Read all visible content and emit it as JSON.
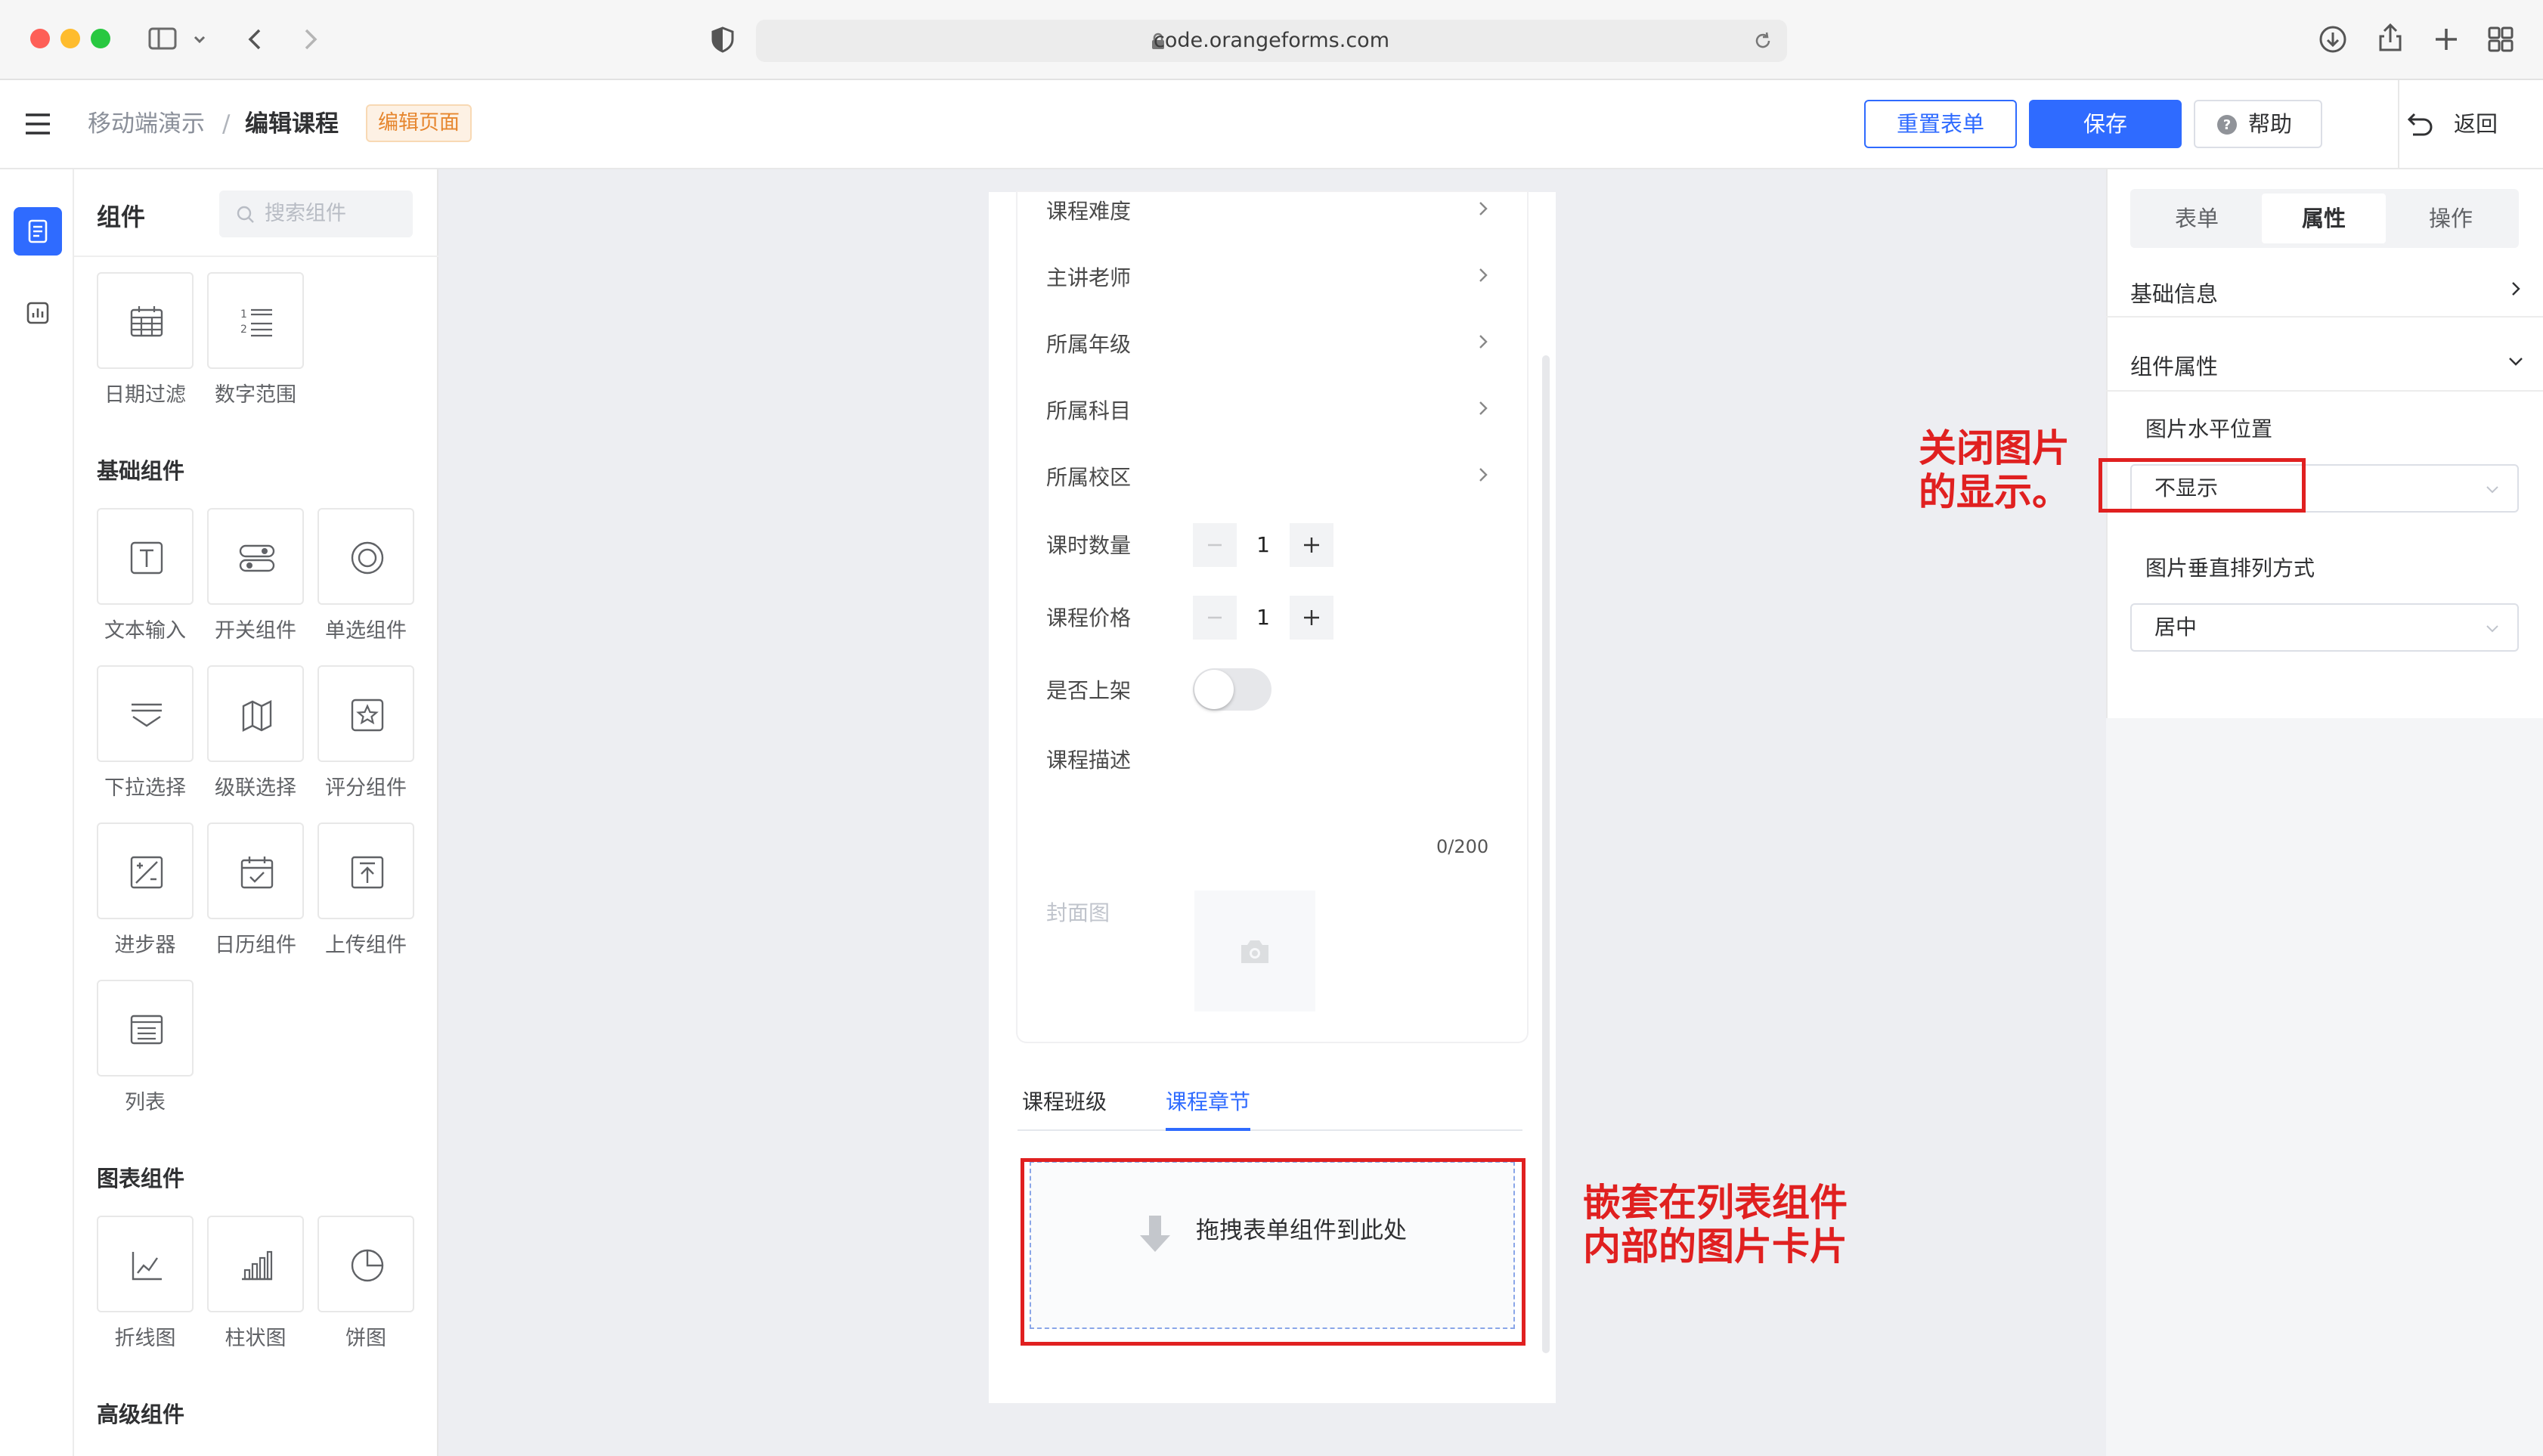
{
  "browser": {
    "url": "code.orangeforms.com"
  },
  "header": {
    "breadcrumb_root": "移动端演示",
    "breadcrumb_sep": "/",
    "breadcrumb_current": "编辑课程",
    "tag": "编辑页面",
    "reset_label": "重置表单",
    "save_label": "保存",
    "help_label": "帮助",
    "back_label": "返回"
  },
  "components": {
    "title": "组件",
    "search_placeholder": "搜索组件",
    "filter_items": [
      {
        "label": "日期过滤",
        "icon": "calendar-grid-icon"
      },
      {
        "label": "数字范围",
        "icon": "numbered-list-icon"
      }
    ],
    "basic_title": "基础组件",
    "basic_items": [
      {
        "label": "文本输入",
        "icon": "text-input-icon"
      },
      {
        "label": "开关组件",
        "icon": "switch-icon"
      },
      {
        "label": "单选组件",
        "icon": "radio-icon"
      },
      {
        "label": "下拉选择",
        "icon": "dropdown-icon"
      },
      {
        "label": "级联选择",
        "icon": "cascader-icon"
      },
      {
        "label": "评分组件",
        "icon": "star-rate-icon"
      },
      {
        "label": "进步器",
        "icon": "stepper-icon"
      },
      {
        "label": "日历组件",
        "icon": "calendar-check-icon"
      },
      {
        "label": "上传组件",
        "icon": "upload-icon"
      },
      {
        "label": "列表",
        "icon": "list-icon"
      }
    ],
    "chart_title": "图表组件",
    "chart_items": [
      {
        "label": "折线图",
        "icon": "line-chart-icon"
      },
      {
        "label": "柱状图",
        "icon": "bar-chart-icon"
      },
      {
        "label": "饼图",
        "icon": "pie-chart-icon"
      }
    ],
    "advanced_title": "高级组件"
  },
  "form": {
    "rows": [
      "课程难度",
      "主讲老师",
      "所属年级",
      "所属科目",
      "所属校区"
    ],
    "hours_label": "课时数量",
    "hours_value": "1",
    "price_label": "课程价格",
    "price_value": "1",
    "on_shelf_label": "是否上架",
    "on_shelf_value": false,
    "desc_label": "课程描述",
    "desc_counter": "0/200",
    "cover_label": "封面图",
    "tabs": [
      "课程班级",
      "课程章节"
    ],
    "active_tab": "课程章节",
    "drop_text": "拖拽表单组件到此处"
  },
  "annotations": {
    "nested_line1": "嵌套在列表组件",
    "nested_line2": "内部的图片卡片",
    "close_line1": "关闭图片",
    "close_line2": "的显示。"
  },
  "right_panel": {
    "tabs": [
      "表单",
      "属性",
      "操作"
    ],
    "active_tab": "属性",
    "basic_info": "基础信息",
    "component_props": "组件属性",
    "h_position_label": "图片水平位置",
    "h_position_value": "不显示",
    "v_align_label": "图片垂直排列方式",
    "v_align_value": "居中"
  },
  "colors": {
    "primary": "#2f6bff",
    "annotation_red": "#e02020",
    "tag_orange": "#e6862e"
  }
}
